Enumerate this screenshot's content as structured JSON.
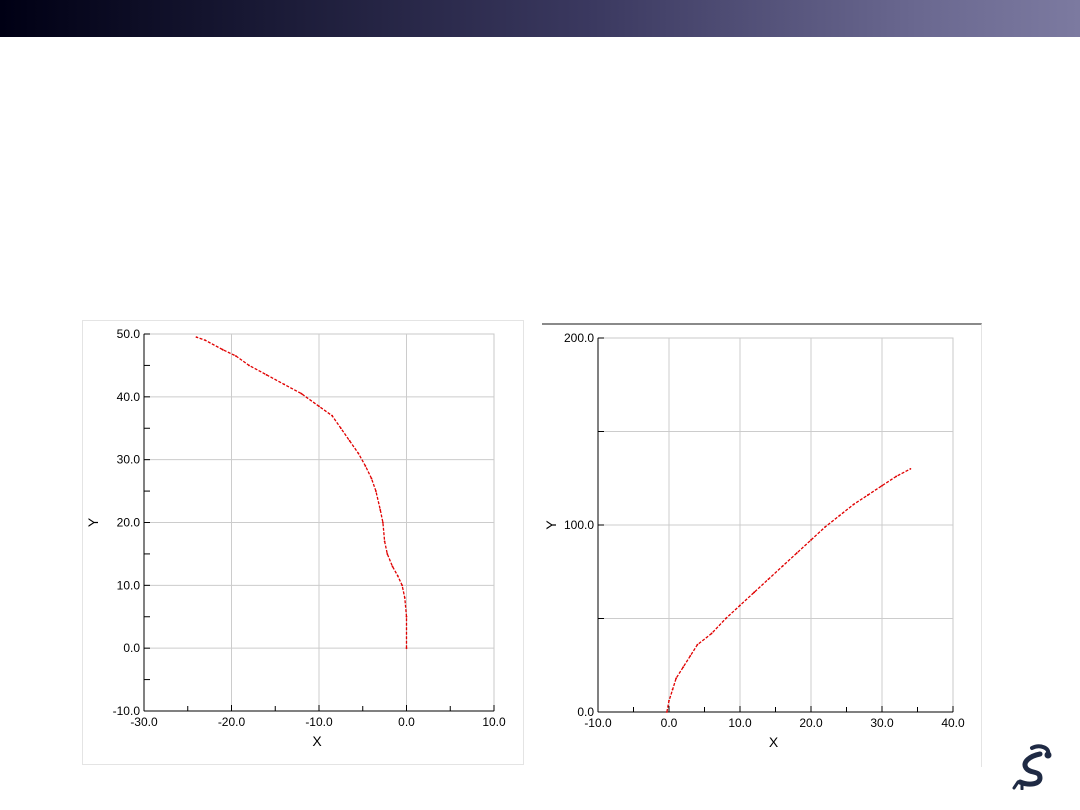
{
  "header": {
    "bar_color_start": "#000014",
    "bar_color_end": "#7c7aa0"
  },
  "logo": {
    "icon": "robot-arm-logo-icon",
    "color": "#1f2a44"
  },
  "chart_data": [
    {
      "type": "line",
      "title": "",
      "xlabel": "X",
      "ylabel": "Y",
      "xlim": [
        -30,
        10
      ],
      "ylim": [
        -10,
        50
      ],
      "grid": true,
      "x_ticks": [
        -30,
        -20,
        -10,
        0,
        10
      ],
      "x_tick_labels": [
        "-30.0",
        "-20.0",
        "-10.0",
        "0.0",
        "10.0"
      ],
      "y_ticks": [
        -10,
        0,
        10,
        20,
        30,
        40,
        50
      ],
      "y_tick_labels": [
        "-10.0",
        "0.0",
        "10.0",
        "20.0",
        "30.0",
        "40.0",
        "50.0"
      ],
      "series_color": "#e00000",
      "series": [
        {
          "x": [
            0,
            0,
            -0.2,
            -0.5,
            -1,
            -1.6,
            -2.2,
            -2.5,
            -2.7,
            -3,
            -3.5,
            -4,
            -4.7,
            -5.5,
            -6.5,
            -7.5,
            -8.5,
            -10,
            -12,
            -14,
            -16,
            -18,
            -19.5,
            -21,
            -23,
            -24
          ],
          "y": [
            0,
            5,
            8,
            10,
            11.5,
            13,
            15,
            17,
            20,
            22,
            25,
            27,
            29,
            31,
            33,
            35,
            37,
            38.5,
            40.5,
            42,
            43.5,
            45,
            46.5,
            47.5,
            49,
            49.5
          ]
        }
      ]
    },
    {
      "type": "line",
      "title": "",
      "xlabel": "X",
      "ylabel": "Y",
      "xlim": [
        -10,
        40
      ],
      "ylim": [
        0,
        200
      ],
      "grid": true,
      "x_ticks": [
        -10,
        0,
        10,
        20,
        30,
        40
      ],
      "x_tick_labels": [
        "-10.0",
        "0.0",
        "10.0",
        "20.0",
        "30.0",
        "40.0"
      ],
      "y_ticks": [
        0,
        100,
        200
      ],
      "y_tick_labels": [
        "0.0",
        "100.0",
        "200.0"
      ],
      "series_color": "#e00000",
      "series": [
        {
          "x": [
            -0.3,
            0,
            0.5,
            1,
            2,
            3,
            4,
            6,
            8,
            10,
            12,
            14,
            16,
            18,
            20,
            22,
            24,
            26,
            28,
            30,
            32,
            34
          ],
          "y": [
            0,
            6,
            12,
            18,
            24,
            30,
            36,
            42,
            50,
            57,
            64,
            71,
            78,
            85,
            92,
            99,
            105,
            111,
            116,
            121,
            126,
            130
          ]
        }
      ]
    }
  ]
}
